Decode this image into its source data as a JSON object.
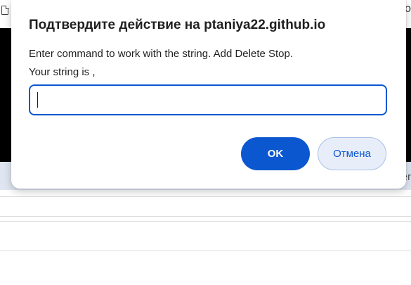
{
  "background": {
    "corner_text": "o",
    "tabstrip_cut_text": "er"
  },
  "dialog": {
    "title": "Подтвердите действие на ptaniya22.github.io",
    "message": "Enter command to work with the string. Add Delete Stop.\nYour string is ,",
    "input_value": "",
    "ok_label": "OK",
    "cancel_label": "Отмена"
  },
  "colors": {
    "accent": "#0b57d0",
    "cancel_background": "#e8eef9",
    "tabstrip": "#dfe6f2",
    "backdrop_dark": "#000000"
  }
}
